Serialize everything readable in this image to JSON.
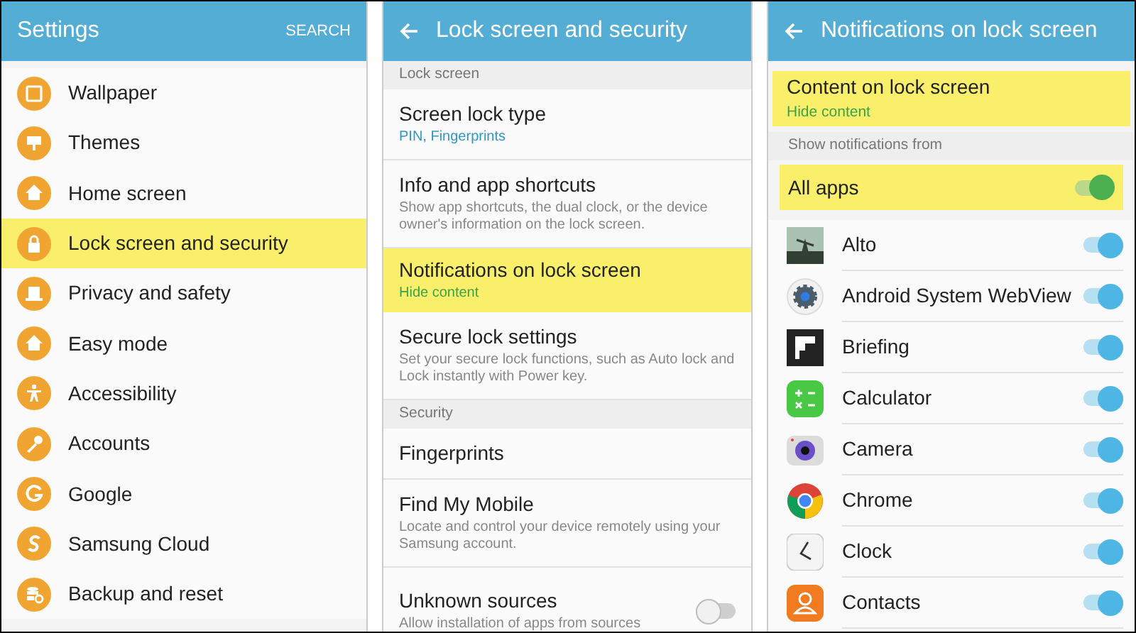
{
  "settings": {
    "title": "Settings",
    "search": "SEARCH",
    "items": [
      {
        "label": "Wallpaper",
        "selected": false
      },
      {
        "label": "Themes",
        "selected": false
      },
      {
        "label": "Home screen",
        "selected": false
      },
      {
        "label": "Lock screen and security",
        "selected": true
      },
      {
        "label": "Privacy and safety",
        "selected": false
      },
      {
        "label": "Easy mode",
        "selected": false
      },
      {
        "label": "Accessibility",
        "selected": false
      },
      {
        "label": "Accounts",
        "selected": false
      },
      {
        "label": "Google",
        "selected": false
      },
      {
        "label": "Samsung Cloud",
        "selected": false
      },
      {
        "label": "Backup and reset",
        "selected": false
      }
    ]
  },
  "lock_screen": {
    "title": "Lock screen and security",
    "sections": [
      {
        "header": "Lock screen",
        "items": [
          {
            "title": "Screen lock type",
            "summary": "PIN, Fingerprints",
            "kind": "value",
            "selected": false
          },
          {
            "title": "Info and app shortcuts",
            "summary": "Show app shortcuts, the dual clock, or the device owner's information on the lock screen.",
            "kind": "description",
            "selected": false
          },
          {
            "title": "Notifications on lock screen",
            "summary": "Hide content",
            "kind": "value",
            "selected": true
          },
          {
            "title": "Secure lock settings",
            "summary": "Set your secure lock functions, such as Auto lock and Lock instantly with Power key.",
            "kind": "description",
            "selected": false
          }
        ]
      },
      {
        "header": "Security",
        "items": [
          {
            "title": "Fingerprints",
            "selected": false
          },
          {
            "title": "Find My Mobile",
            "summary": "Locate and control your device remotely using your Samsung account.",
            "kind": "description",
            "selected": false
          },
          {
            "title": "Unknown sources",
            "summary": "Allow installation of apps from sources",
            "kind": "description",
            "selected": false,
            "on": false
          }
        ]
      }
    ]
  },
  "notifications": {
    "title": "Notifications on lock screen",
    "content": {
      "title": "Content on lock screen",
      "summary": "Hide content",
      "selected": true
    },
    "header": "Show notifications from",
    "all_apps": {
      "label": "All apps",
      "on": true,
      "selected": true
    },
    "apps": [
      {
        "name": "Alto",
        "on": true
      },
      {
        "name": "Android System WebView",
        "on": true
      },
      {
        "name": "Briefing",
        "on": true
      },
      {
        "name": "Calculator",
        "on": true
      },
      {
        "name": "Camera",
        "on": true
      },
      {
        "name": "Chrome",
        "on": true
      },
      {
        "name": "Clock",
        "on": true
      },
      {
        "name": "Contacts",
        "on": true
      }
    ]
  }
}
